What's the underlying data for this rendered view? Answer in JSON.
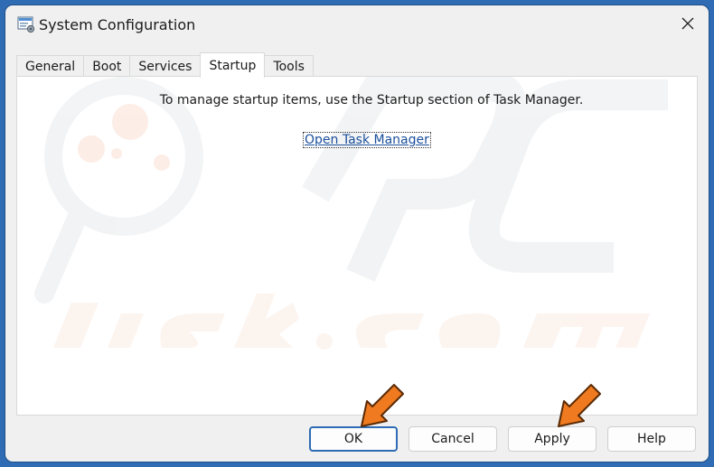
{
  "window": {
    "title": "System Configuration",
    "close_glyph": "✕"
  },
  "tabs": [
    {
      "label": "General",
      "active": false
    },
    {
      "label": "Boot",
      "active": false
    },
    {
      "label": "Services",
      "active": false
    },
    {
      "label": "Startup",
      "active": true
    },
    {
      "label": "Tools",
      "active": false
    }
  ],
  "startup_panel": {
    "message": "To manage startup items, use the Startup section of Task Manager.",
    "link_label": "Open Task Manager"
  },
  "buttons": {
    "ok": "OK",
    "cancel": "Cancel",
    "apply": "Apply",
    "help": "Help"
  },
  "colors": {
    "frame": "#2f6cb3",
    "accent_arrow": "#f07a1f",
    "link": "#1a4f9c"
  },
  "icons": {
    "app": "system-configuration-icon",
    "close": "close-icon",
    "annotation": "orange-arrow-icon"
  }
}
